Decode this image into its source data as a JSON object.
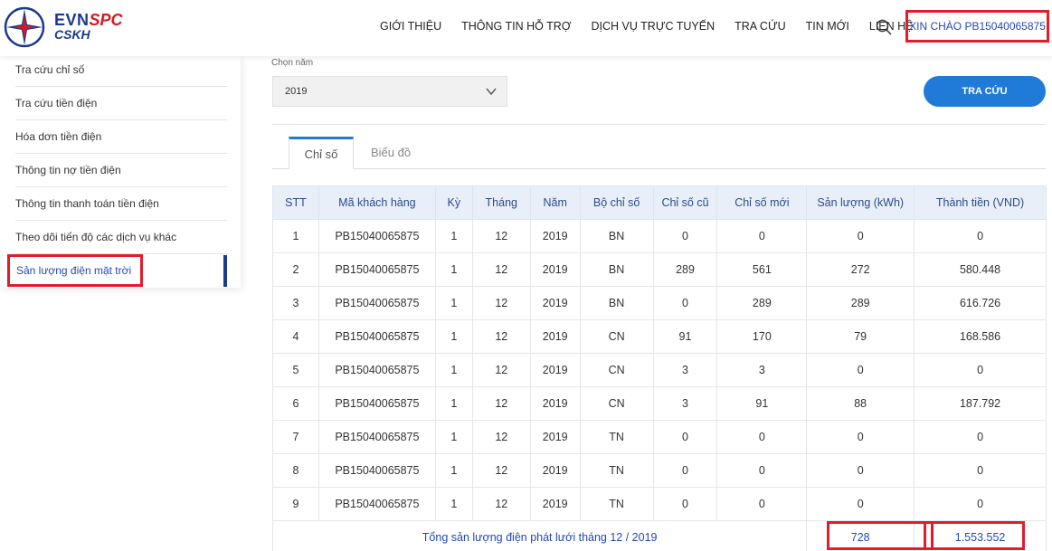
{
  "header": {
    "logo": {
      "brand_evn": "EVN",
      "brand_spc": "SPC",
      "brand_cskh": "CSKH"
    },
    "nav": [
      "GIỚI THIỆU",
      "THÔNG TIN HỖ TRỢ",
      "DỊCH VỤ TRỰC TUYẾN",
      "TRA CỨU",
      "TIN MỚI",
      "LIÊN HỆ"
    ],
    "search_icon": "search-icon",
    "greeting": "XIN CHÀO PB15040065875"
  },
  "sidebar": {
    "items": [
      "Tra cứu chỉ số",
      "Tra cứu tiền điện",
      "Hóa dơn tiền điện",
      "Thông tin nợ tiền điện",
      "Thông tin thanh toán tiền điện",
      "Theo dõi tiến độ các dịch vụ khác",
      "Sản lượng điện mặt trời"
    ],
    "active_index": 6
  },
  "filter": {
    "year_label": "Chọn năm",
    "year_value": "2019",
    "search_button": "TRA CỨU"
  },
  "tabs": [
    "Chỉ số",
    "Biểu đồ"
  ],
  "table": {
    "headers": [
      "STT",
      "Mã khách hàng",
      "Kỳ",
      "Tháng",
      "Năm",
      "Bộ chỉ số",
      "Chỉ số cũ",
      "Chỉ số mới",
      "Sản lượng (kWh)",
      "Thành tiền (VND)"
    ],
    "rows": [
      [
        "1",
        "PB15040065875",
        "1",
        "12",
        "2019",
        "BN",
        "0",
        "0",
        "0",
        "0"
      ],
      [
        "2",
        "PB15040065875",
        "1",
        "12",
        "2019",
        "BN",
        "289",
        "561",
        "272",
        "580.448"
      ],
      [
        "3",
        "PB15040065875",
        "1",
        "12",
        "2019",
        "BN",
        "0",
        "289",
        "289",
        "616.726"
      ],
      [
        "4",
        "PB15040065875",
        "1",
        "12",
        "2019",
        "CN",
        "91",
        "170",
        "79",
        "168.586"
      ],
      [
        "5",
        "PB15040065875",
        "1",
        "12",
        "2019",
        "CN",
        "3",
        "3",
        "0",
        "0"
      ],
      [
        "6",
        "PB15040065875",
        "1",
        "12",
        "2019",
        "CN",
        "3",
        "91",
        "88",
        "187.792"
      ],
      [
        "7",
        "PB15040065875",
        "1",
        "12",
        "2019",
        "TN",
        "0",
        "0",
        "0",
        "0"
      ],
      [
        "8",
        "PB15040065875",
        "1",
        "12",
        "2019",
        "TN",
        "0",
        "0",
        "0",
        "0"
      ],
      [
        "9",
        "PB15040065875",
        "1",
        "12",
        "2019",
        "TN",
        "0",
        "0",
        "0",
        "0"
      ]
    ],
    "total": {
      "label": "Tổng sản lượng điện phát lưới tháng 12 / 2019",
      "kwh": "728",
      "amount": "1.553.552"
    }
  },
  "colors": {
    "brand_blue": "#1a3a8f",
    "brand_red": "#d71920",
    "accent": "#1f7ad8",
    "highlight": "#e21c2a"
  }
}
